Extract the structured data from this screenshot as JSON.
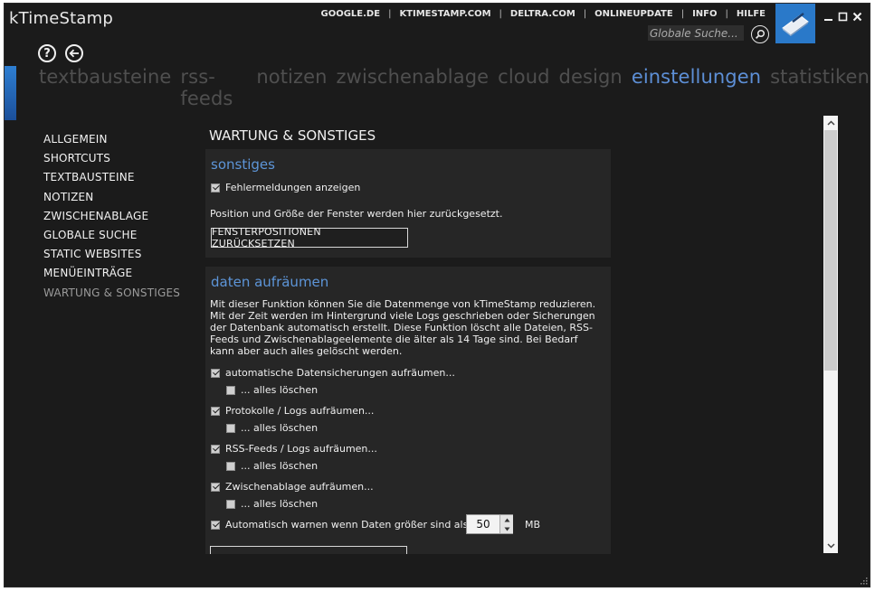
{
  "app": {
    "title": "kTimeStamp"
  },
  "toplinks": [
    "GOOGLE.DE",
    "KTIMESTAMP.COM",
    "DELTRA.COM",
    "ONLINEUPDATE",
    "INFO",
    "HILFE"
  ],
  "search": {
    "placeholder": "Globale Suche..."
  },
  "nav": {
    "help_glyph": "?",
    "back_glyph": "←"
  },
  "tabs": [
    {
      "label": "textbausteine",
      "active": false
    },
    {
      "label": "rss-feeds",
      "active": false
    },
    {
      "label": "notizen",
      "active": false
    },
    {
      "label": "zwischenablage",
      "active": false
    },
    {
      "label": "cloud",
      "active": false
    },
    {
      "label": "design",
      "active": false
    },
    {
      "label": "einstellungen",
      "active": true
    },
    {
      "label": "statistiken",
      "active": false
    }
  ],
  "sidebar": {
    "items": [
      {
        "label": "ALLGEMEIN",
        "active": false
      },
      {
        "label": "SHORTCUTS",
        "active": false
      },
      {
        "label": "TEXTBAUSTEINE",
        "active": false
      },
      {
        "label": "NOTIZEN",
        "active": false
      },
      {
        "label": "ZWISCHENABLAGE",
        "active": false
      },
      {
        "label": "GLOBALE SUCHE",
        "active": false
      },
      {
        "label": "STATIC WEBSITES",
        "active": false
      },
      {
        "label": "MENÜEINTRÄGE",
        "active": false
      },
      {
        "label": "WARTUNG & SONSTIGES",
        "active": true
      }
    ]
  },
  "main": {
    "section_title": "WARTUNG & SONSTIGES",
    "sonstiges": {
      "title": "sonstiges",
      "show_errors_label": "Fehlermeldungen anzeigen",
      "show_errors_checked": true,
      "reset_text": "Position und Größe der Fenster werden hier zurückgesetzt.",
      "reset_button": "FENSTERPOSITIONEN ZURÜCKSETZEN"
    },
    "cleanup": {
      "title": "daten aufräumen",
      "description": "Mit dieser Funktion können Sie die Datenmenge von kTimeStamp reduzieren. Mit der Zeit werden im Hintergrund viele Logs geschrieben oder Sicherungen der Datenbank automatisch erstellt. Diese Funktion löscht alle Dateien, RSS-Feeds und Zwischenablageelemente die älter als 14 Tage sind. Bei Bedarf kann aber auch alles gelöscht werden.",
      "options": [
        {
          "label": "automatische Datensicherungen aufräumen...",
          "checked": true,
          "sub_label": "... alles löschen",
          "sub_checked": false
        },
        {
          "label": "Protokolle / Logs  aufräumen...",
          "checked": true,
          "sub_label": "... alles löschen",
          "sub_checked": false
        },
        {
          "label": "RSS-Feeds / Logs  aufräumen...",
          "checked": true,
          "sub_label": "... alles löschen",
          "sub_checked": false
        },
        {
          "label": "Zwischenablage  aufräumen...",
          "checked": true,
          "sub_label": "... alles löschen",
          "sub_checked": false
        }
      ],
      "warn_label": "Automatisch warnen wenn Daten größer sind als:",
      "warn_checked": true,
      "warn_value": "50",
      "warn_unit": "MB"
    }
  },
  "colors": {
    "background": "#1b1b1b",
    "panel": "#262626",
    "accent": "#5d8fd6",
    "logo_tile": "#2a79c9"
  }
}
